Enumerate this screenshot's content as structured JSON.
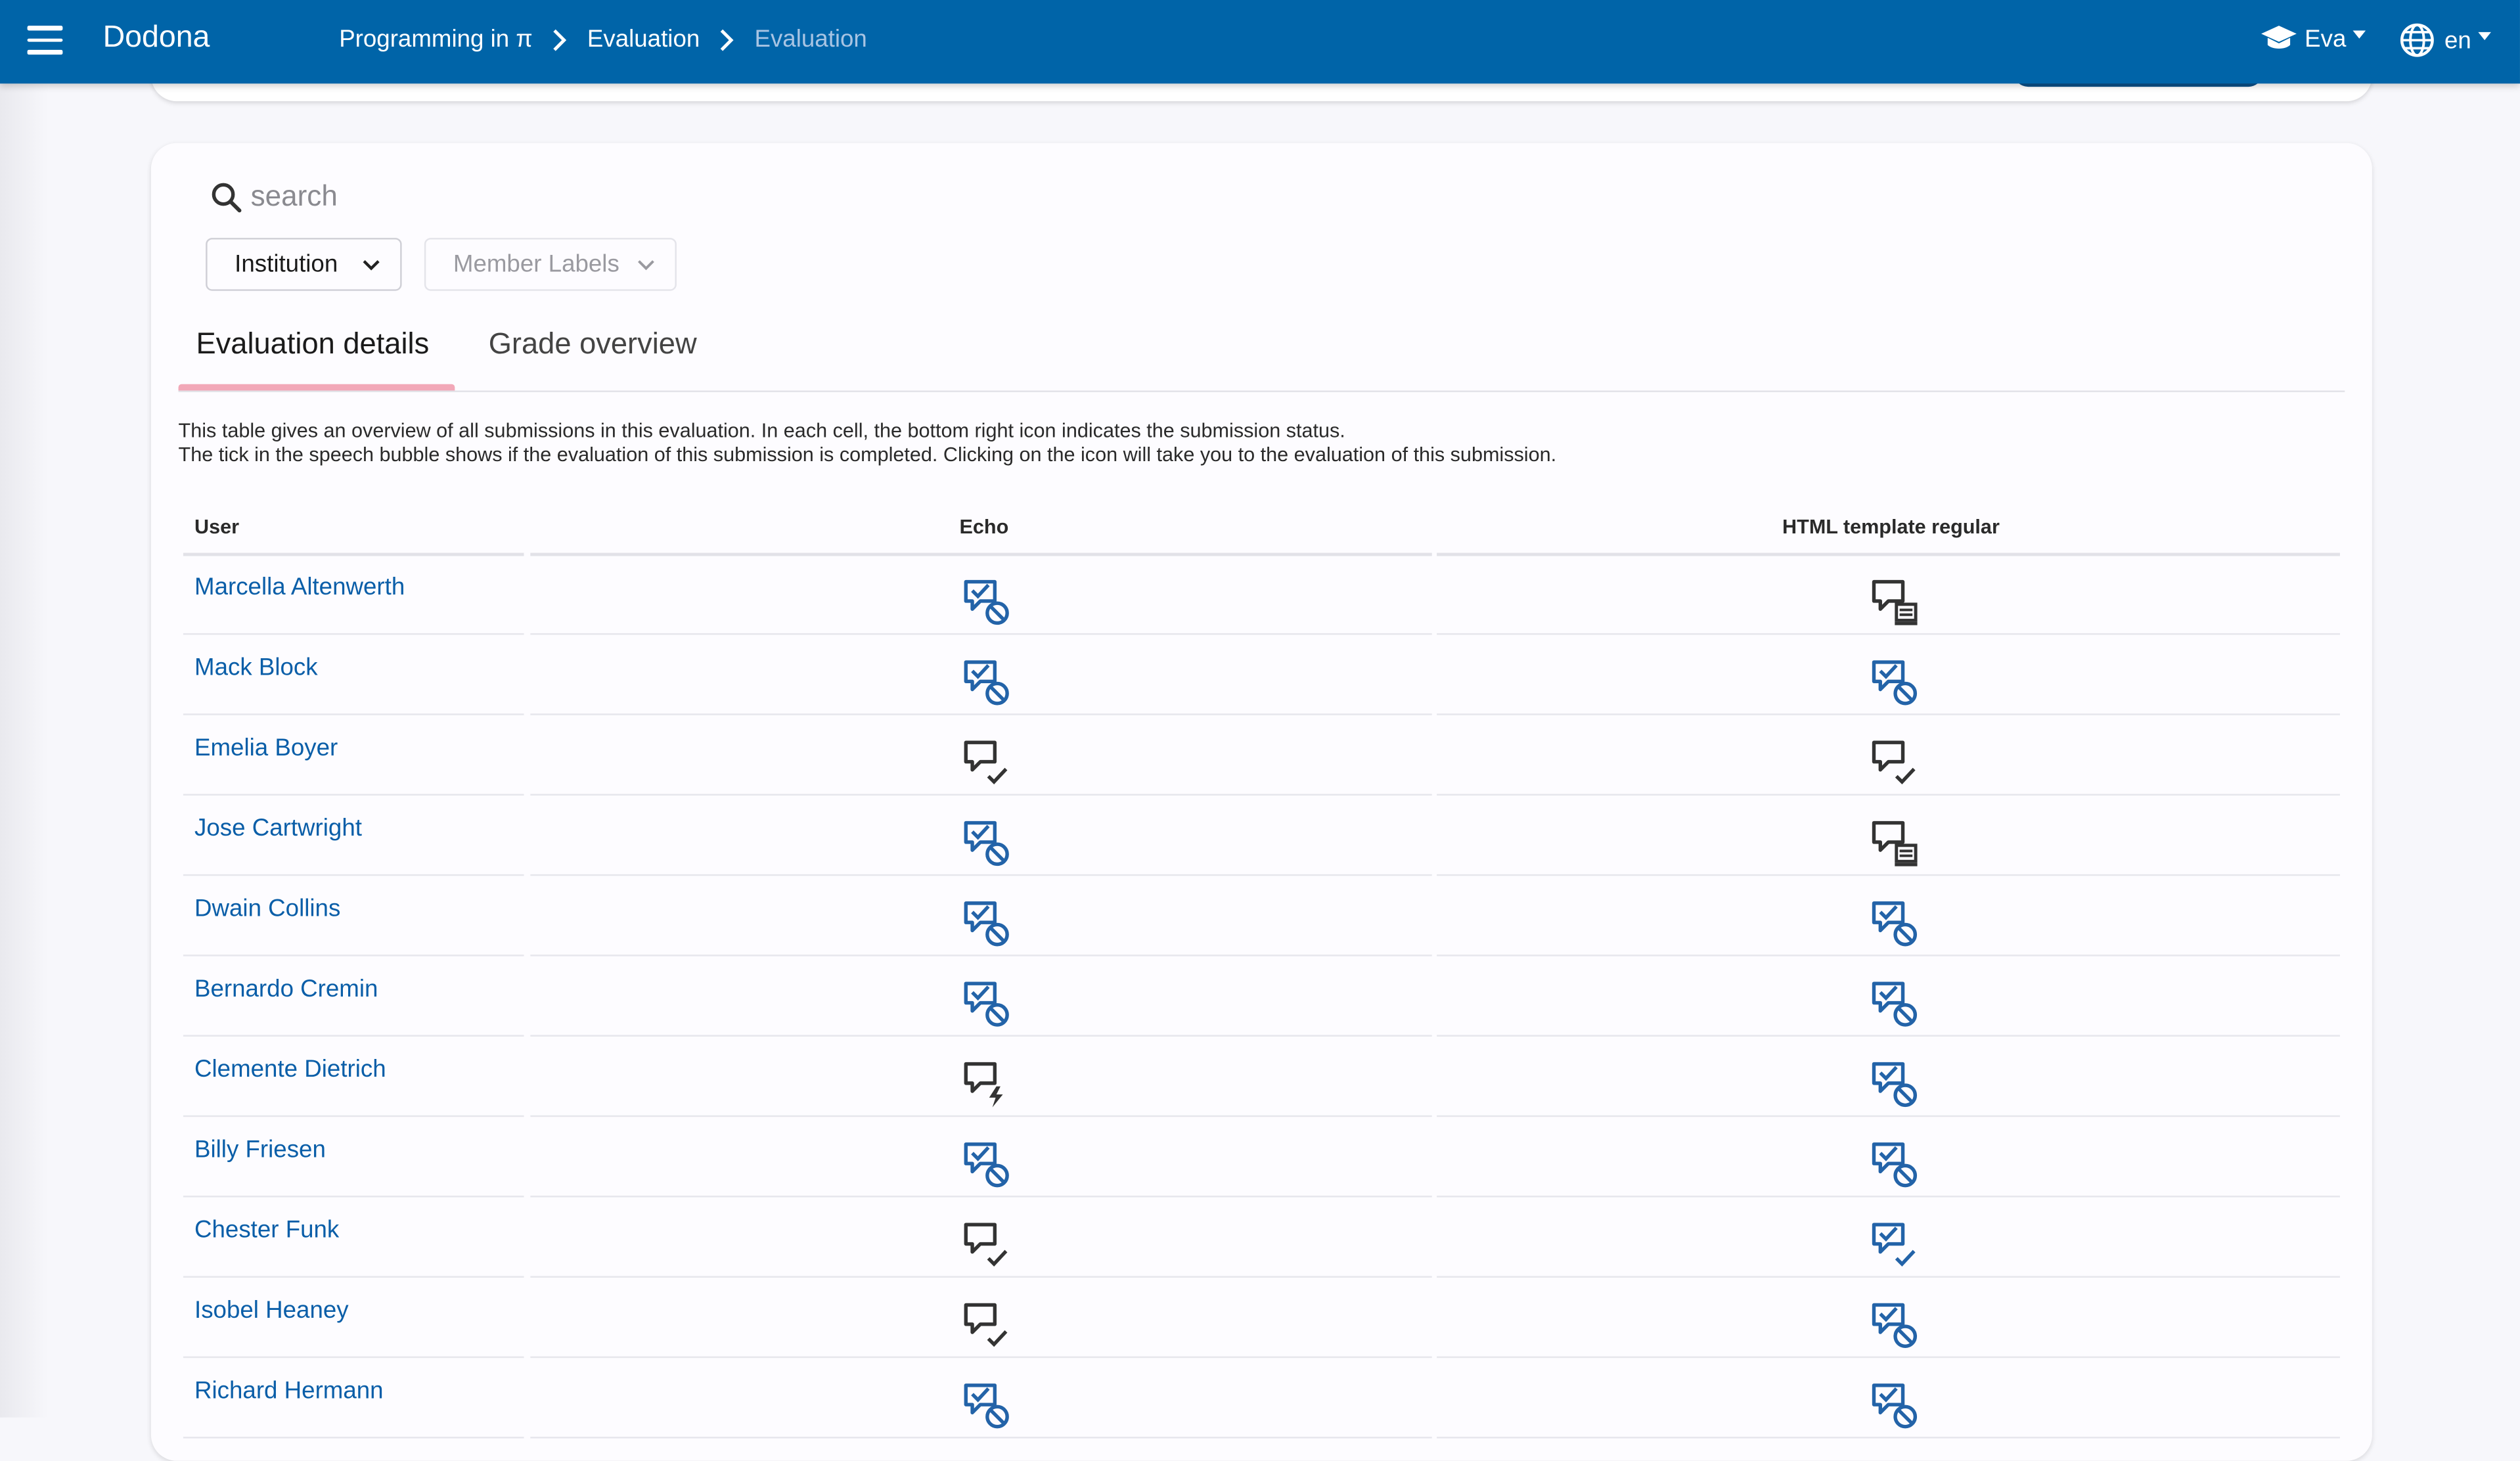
{
  "navbar": {
    "brand": "Dodona",
    "breadcrumbs": [
      "Programming in π",
      "Evaluation",
      "Evaluation"
    ],
    "user": "Eva",
    "language": "en"
  },
  "search": {
    "placeholder": "search"
  },
  "filters": {
    "institution": "Institution",
    "member_labels": "Member Labels"
  },
  "tabs": {
    "details": "Evaluation details",
    "grades": "Grade overview"
  },
  "description": {
    "line1": "This table gives an overview of all submissions in this evaluation. In each cell, the bottom right icon indicates the submission status.",
    "line2": "The tick in the speech bubble shows if the evaluation of this submission is completed. Clicking on the icon will take you to the evaluation of this submission."
  },
  "table": {
    "headers": {
      "user": "User",
      "col1": "Echo",
      "col2": "HTML template regular"
    },
    "rows": [
      {
        "user": "Marcella Altenwerth",
        "echo": "completed-none",
        "html": "pending-running"
      },
      {
        "user": "Mack Block",
        "echo": "completed-none",
        "html": "completed-none"
      },
      {
        "user": "Emelia Boyer",
        "echo": "pending-correct",
        "html": "pending-correct"
      },
      {
        "user": "Jose Cartwright",
        "echo": "completed-none",
        "html": "pending-running"
      },
      {
        "user": "Dwain Collins",
        "echo": "completed-none",
        "html": "completed-none"
      },
      {
        "user": "Bernardo Cremin",
        "echo": "completed-none",
        "html": "completed-none"
      },
      {
        "user": "Clemente Dietrich",
        "echo": "pending-error",
        "html": "completed-none"
      },
      {
        "user": "Billy Friesen",
        "echo": "completed-none",
        "html": "completed-none"
      },
      {
        "user": "Chester Funk",
        "echo": "pending-correct",
        "html": "completed-correct"
      },
      {
        "user": "Isobel Heaney",
        "echo": "pending-correct",
        "html": "completed-none"
      },
      {
        "user": "Richard Hermann",
        "echo": "completed-none",
        "html": "completed-none"
      }
    ]
  },
  "colors": {
    "primary": "#0064a8",
    "link": "#0a5ea8",
    "icon_completed": "#2363a8",
    "icon_pending": "#333333",
    "tab_indicator": "#f2a8b8"
  }
}
